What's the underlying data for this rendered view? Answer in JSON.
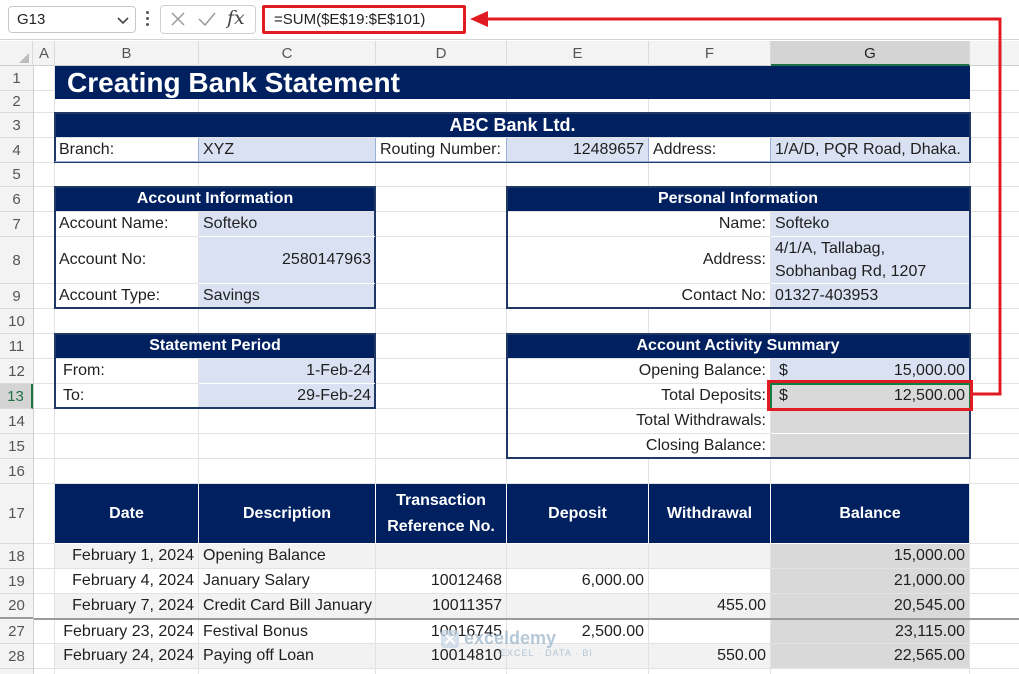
{
  "formula_bar": {
    "name_box": "G13",
    "formula": "=SUM($E$19:$E$101)",
    "fx_label": "fx"
  },
  "columns": [
    "A",
    "B",
    "C",
    "D",
    "E",
    "F",
    "G"
  ],
  "rows": [
    "1",
    "2",
    "3",
    "4",
    "5",
    "6",
    "7",
    "8",
    "9",
    "10",
    "11",
    "12",
    "13",
    "14",
    "15",
    "16",
    "17",
    "18",
    "19",
    "20",
    "27",
    "28"
  ],
  "sheet": {
    "title": "Creating Bank Statement",
    "bank": {
      "name": "ABC Bank Ltd.",
      "branch_label": "Branch:",
      "branch_value": "XYZ",
      "routing_label": "Routing Number:",
      "routing_value": "12489657",
      "address_label": "Address:",
      "address_value": "1/A/D, PQR Road, Dhaka."
    },
    "account_info": {
      "header": "Account Information",
      "name_label": "Account Name:",
      "name_value": "Softeko",
      "no_label": "Account No:",
      "no_value": "2580147963",
      "type_label": "Account Type:",
      "type_value": "Savings"
    },
    "personal_info": {
      "header": "Personal Information",
      "name_label": "Name:",
      "name_value": "Softeko",
      "address_label": "Address:",
      "address_line1": "4/1/A, Tallabag,",
      "address_line2": "Sobhanbag Rd, 1207",
      "contact_label": "Contact No:",
      "contact_value": "01327-403953"
    },
    "statement_period": {
      "header": "Statement Period",
      "from_label": "From:",
      "from_value": "1-Feb-24",
      "to_label": "To:",
      "to_value": "29-Feb-24"
    },
    "summary": {
      "header": "Account Activity Summary",
      "opening_label": "Opening Balance:",
      "opening_currency": "$",
      "opening_value": "15,000.00",
      "deposits_label": "Total Deposits:",
      "deposits_currency": "$",
      "deposits_value": "12,500.00",
      "withdrawals_label": "Total Withdrawals:",
      "closing_label": "Closing Balance:"
    },
    "transactions": {
      "headers": {
        "date": "Date",
        "description": "Description",
        "ref_line1": "Transaction",
        "ref_line2": "Reference No.",
        "deposit": "Deposit",
        "withdrawal": "Withdrawal",
        "balance": "Balance"
      },
      "rows": [
        {
          "date": "February 1, 2024",
          "description": "Opening Balance",
          "ref": "",
          "deposit": "",
          "withdrawal": "",
          "balance": "15,000.00"
        },
        {
          "date": "February 4, 2024",
          "description": "January Salary",
          "ref": "10012468",
          "deposit": "6,000.00",
          "withdrawal": "",
          "balance": "21,000.00"
        },
        {
          "date": "February 7, 2024",
          "description": "Credit Card Bill January",
          "ref": "10011357",
          "deposit": "",
          "withdrawal": "455.00",
          "balance": "20,545.00"
        },
        {
          "date": "February 23, 2024",
          "description": "Festival Bonus",
          "ref": "10016745",
          "deposit": "2,500.00",
          "withdrawal": "",
          "balance": "23,115.00"
        },
        {
          "date": "February 24, 2024",
          "description": "Paying off Loan",
          "ref": "10014810",
          "deposit": "",
          "withdrawal": "550.00",
          "balance": "22,565.00"
        }
      ]
    }
  },
  "watermark": {
    "brand": "exceldemy",
    "tagline": "EXCEL · DATA · BI"
  },
  "colors": {
    "navy": "#002060",
    "lavender": "#d9e1f2",
    "highlight_red": "#e11b22",
    "selection_green": "#107c41"
  }
}
